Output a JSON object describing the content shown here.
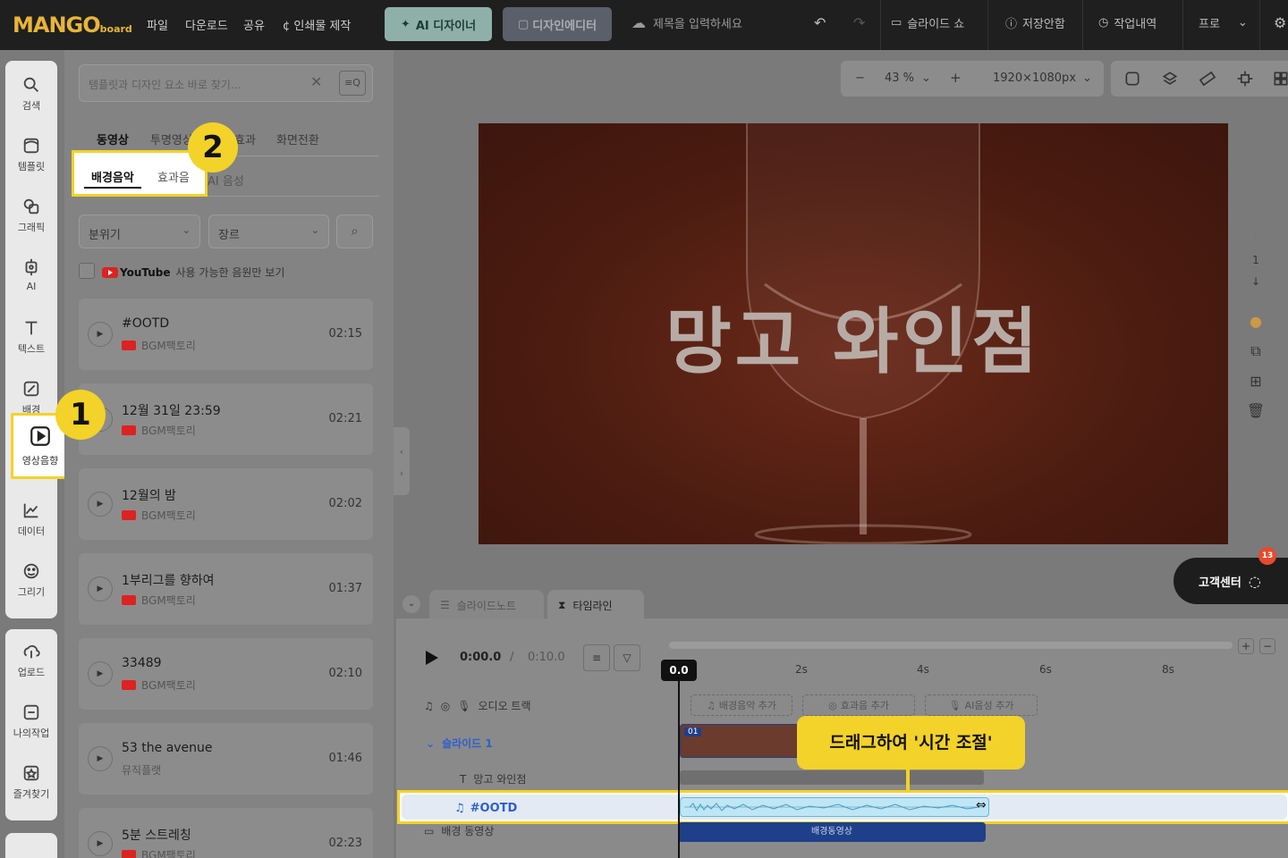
{
  "app": {
    "logo_main": "MANGO",
    "logo_sub": "board",
    "menu": [
      "파일",
      "다운로드",
      "공유",
      "인쇄물 제작"
    ],
    "ai_designer": "AI 디자이너",
    "design_editor": "디자인에디터",
    "title_placeholder": "제목을 입력하세요",
    "slide_show": "슬라이드 쇼",
    "save_status": "저장안함",
    "history": "작업내역",
    "pro": "프로"
  },
  "rail": {
    "items": [
      "검색",
      "템플릿",
      "그래픽",
      "AI",
      "텍스트",
      "배경",
      "영상음향",
      "데이터",
      "그리기"
    ],
    "items2": [
      "업로드",
      "나의작업",
      "즐겨찾기"
    ]
  },
  "panel": {
    "search_placeholder": "템플릿과 디자인 요소 바로 찾기...",
    "search_btn": "≡Q",
    "tabs": [
      "동영상",
      "투명영상",
      "효과",
      "화면전환"
    ],
    "subtabs": [
      "배경음악",
      "효과음",
      "AI 음성"
    ],
    "filter_mood": "분위기",
    "filter_genre": "장르",
    "youtube_label": "YouTube",
    "youtube_only": "사용 가능한 음원만 보기",
    "tracks": [
      {
        "name": "#OOTD",
        "source": "BGM팩토리",
        "duration": "02:15"
      },
      {
        "name": "12월 31일 23:59",
        "source": "BGM팩토리",
        "duration": "02:21"
      },
      {
        "name": "12월의 밤",
        "source": "BGM팩토리",
        "duration": "02:02"
      },
      {
        "name": "1부리그를 향하여",
        "source": "BGM팩토리",
        "duration": "01:37"
      },
      {
        "name": "33489",
        "source": "BGM팩토리",
        "duration": "02:10"
      },
      {
        "name": "53 the avenue",
        "source": "뮤직플랫",
        "duration": "01:46"
      },
      {
        "name": "5분 스트레칭",
        "source": "BGM팩토리",
        "duration": "02:23"
      }
    ]
  },
  "canvas": {
    "zoom": "43 %",
    "size": "1920×1080px",
    "title": "망고 와인점",
    "page_number": "1"
  },
  "help": {
    "label": "고객센터",
    "badge": "13"
  },
  "timeline": {
    "tabs": [
      "슬라이드노트",
      "타임라인"
    ],
    "current_time": "0:00.0",
    "separator": "/",
    "total_time": "0:10.0",
    "playhead": "0.0",
    "ruler": [
      "2s",
      "4s",
      "6s",
      "8s"
    ],
    "audio_track": "오디오 트랙",
    "add_bgm": "배경음악 추가",
    "add_sfx": "효과음 추가",
    "add_ai": "AI음성 추가",
    "slide": "슬라이드 1",
    "clip_num": "01",
    "text_layer": "망고 와인점",
    "audio_name": "#OOTD",
    "bg_video": "배경 동영상",
    "bg_clip": "배경동영상"
  },
  "annotations": {
    "badge1": "1",
    "badge2": "2",
    "tooltip": "드래그하여 '시간 조절'"
  }
}
